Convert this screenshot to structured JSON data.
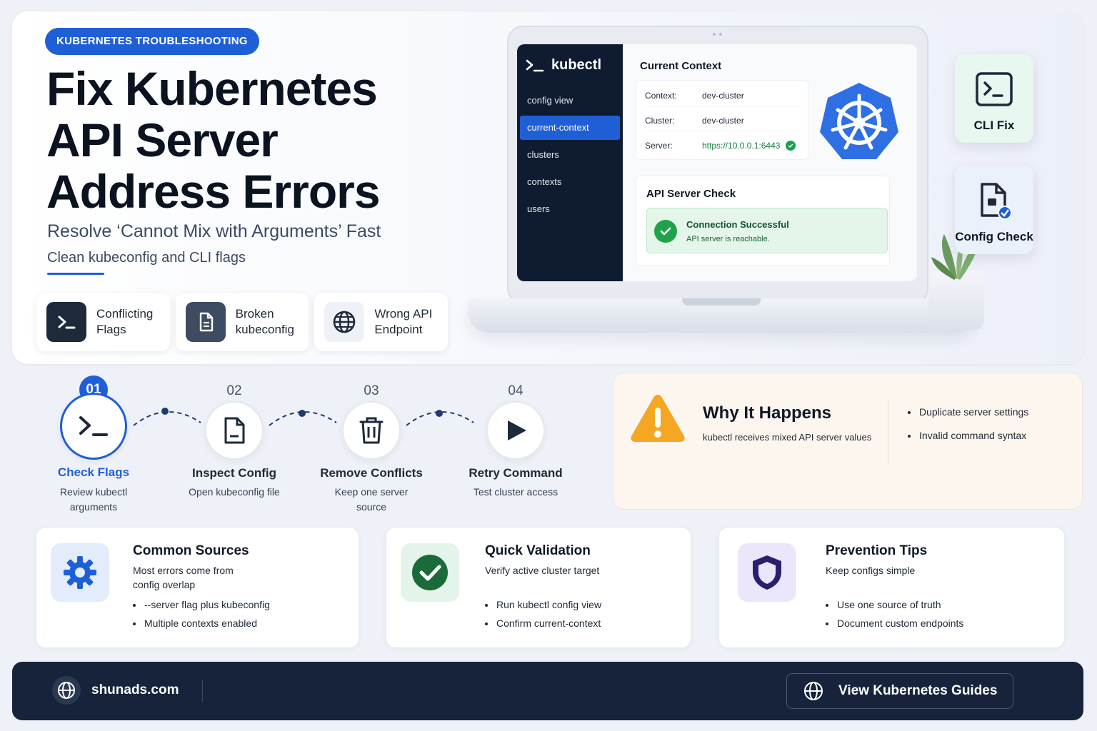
{
  "hero": {
    "badge": "KUBERNETES TROUBLESHOOTING",
    "title": "Fix Kubernetes API Server Address Errors",
    "subtitle": "Resolve ‘Cannot Mix with Arguments’ Fast",
    "subline": "Clean kubeconfig and CLI flags",
    "issues": [
      {
        "label": "Conflicting Flags",
        "icon": "terminal-icon"
      },
      {
        "label": "Broken kubeconfig",
        "icon": "document-icon"
      },
      {
        "label": "Wrong API Endpoint",
        "icon": "globe-icon"
      }
    ]
  },
  "laptop": {
    "brand": "kubectl",
    "nav": [
      "config view",
      "current-context",
      "clusters",
      "contexts",
      "users"
    ],
    "active_nav": "current-context",
    "context_title": "Current Context",
    "context_rows": [
      {
        "key": "Context:",
        "value": "dev-cluster"
      },
      {
        "key": "Cluster:",
        "value": "dev-cluster"
      },
      {
        "key": "Server:",
        "value": "https://10.0.0.1:6443"
      }
    ],
    "api_title": "API Server Check",
    "api_status": "Connection Successful",
    "api_detail": "API server is reachable."
  },
  "side_cards": [
    {
      "label": "CLI Fix",
      "icon": "terminal-icon"
    },
    {
      "label": "Config Check",
      "icon": "file-check-icon"
    }
  ],
  "steps": [
    {
      "num": "01",
      "title": "Check Flags",
      "desc": "Review kubectl arguments",
      "icon": "terminal-icon",
      "active": true
    },
    {
      "num": "02",
      "title": "Inspect Config",
      "desc": "Open kubeconfig file",
      "icon": "document-icon",
      "active": false
    },
    {
      "num": "03",
      "title": "Remove Conflicts",
      "desc": "Keep one server source",
      "icon": "trash-icon",
      "active": false
    },
    {
      "num": "04",
      "title": "Retry Command",
      "desc": "Test cluster access",
      "icon": "play-icon",
      "active": false
    }
  ],
  "why": {
    "title": "Why It Happens",
    "desc": "kubectl receives mixed API server values",
    "items": [
      "Duplicate server settings",
      "Invalid command syntax"
    ]
  },
  "cards": [
    {
      "title": "Common Sources",
      "desc": "Most errors come from config overlap",
      "items": [
        "--server flag plus kubeconfig",
        "Multiple contexts enabled"
      ],
      "icon": "gear-icon"
    },
    {
      "title": "Quick Validation",
      "desc": "Verify active cluster target",
      "items": [
        "Run kubectl config view",
        "Confirm current-context"
      ],
      "icon": "check-circle-icon"
    },
    {
      "title": "Prevention Tips",
      "desc": "Keep configs simple",
      "items": [
        "Use one source of truth",
        "Document custom endpoints"
      ],
      "icon": "shield-icon"
    }
  ],
  "footer": {
    "site": "shunads.com",
    "button": "View Kubernetes Guides"
  },
  "colors": {
    "accent": "#1f5fd6",
    "navy": "#16233b",
    "success": "#16a34a",
    "warning": "#f5a623"
  }
}
